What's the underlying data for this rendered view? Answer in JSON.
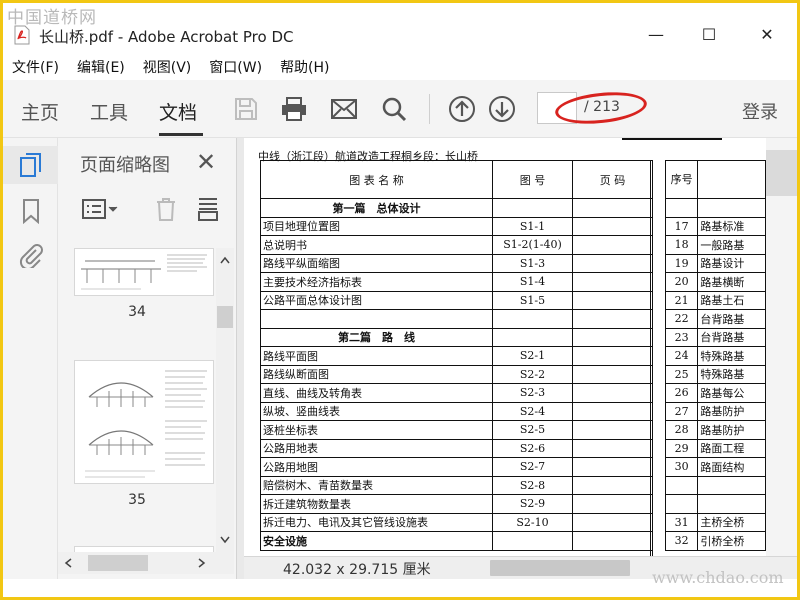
{
  "watermark": {
    "top": "中国道桥网",
    "bottom": "www.chdao.com"
  },
  "window": {
    "title": "长山桥.pdf - Adobe Acrobat Pro DC",
    "minimize": "—",
    "maximize": "☐",
    "close": "✕"
  },
  "menu": [
    "文件(F)",
    "编辑(E)",
    "视图(V)",
    "窗口(W)",
    "帮助(H)"
  ],
  "toolbar": {
    "tabs": [
      "主页",
      "工具",
      "文档"
    ],
    "active_tab": "文档",
    "page_current": "",
    "page_total": "/ 213",
    "login": "登录",
    "accent": "#d8231f"
  },
  "sidebar": {
    "icons": [
      "pages-icon",
      "bookmark-icon",
      "attachment-icon"
    ],
    "selected_color": "#2a7ad5"
  },
  "thumbnails": {
    "title": "页面缩略图",
    "close": "✕",
    "pages": [
      {
        "label": "34"
      },
      {
        "label": "35"
      }
    ]
  },
  "document": {
    "header": "中线（浙江段）航道改造工程桐乡段：长山桥",
    "columns": [
      "图 表 名 称",
      "图 号",
      "页 码"
    ],
    "rows": [
      {
        "name": "第一篇　总体设计",
        "code": "",
        "page": "",
        "section": true
      },
      {
        "name": "项目地理位置图",
        "code": "S1-1",
        "page": ""
      },
      {
        "name": "总说明书",
        "code": "S1-2(1-40)",
        "page": ""
      },
      {
        "name": "路线平纵面缩图",
        "code": "S1-3",
        "page": ""
      },
      {
        "name": "主要技术经济指标表",
        "code": "S1-4",
        "page": ""
      },
      {
        "name": "公路平面总体设计图",
        "code": "S1-5",
        "page": ""
      },
      {
        "name": "",
        "code": "",
        "page": ""
      },
      {
        "name": "第二篇　路　线",
        "code": "",
        "page": "",
        "section": true
      },
      {
        "name": "路线平面图",
        "code": "S2-1",
        "page": ""
      },
      {
        "name": "路线纵断面图",
        "code": "S2-2",
        "page": ""
      },
      {
        "name": "直线、曲线及转角表",
        "code": "S2-3",
        "page": ""
      },
      {
        "name": "纵坡、竖曲线表",
        "code": "S2-4",
        "page": ""
      },
      {
        "name": "逐桩坐标表",
        "code": "S2-5",
        "page": ""
      },
      {
        "name": "公路用地表",
        "code": "S2-6",
        "page": ""
      },
      {
        "name": "公路用地图",
        "code": "S2-7",
        "page": ""
      },
      {
        "name": "赔偿树木、青苗数量表",
        "code": "S2-8",
        "page": ""
      },
      {
        "name": "拆迁建筑物数量表",
        "code": "S2-9",
        "page": ""
      },
      {
        "name": "拆迁电力、电讯及其它管线设施表",
        "code": "S2-10",
        "page": ""
      },
      {
        "name": "安全设施",
        "code": "",
        "page": "",
        "section": true
      }
    ],
    "right_header": "序号",
    "right_rows": [
      {
        "no": "",
        "name": ""
      },
      {
        "no": "17",
        "name": "路基标准"
      },
      {
        "no": "18",
        "name": "一般路基"
      },
      {
        "no": "19",
        "name": "路基设计"
      },
      {
        "no": "20",
        "name": "路基横断"
      },
      {
        "no": "21",
        "name": "路基土石"
      },
      {
        "no": "22",
        "name": "台背路基"
      },
      {
        "no": "23",
        "name": "台背路基"
      },
      {
        "no": "24",
        "name": "特殊路基"
      },
      {
        "no": "25",
        "name": "特殊路基"
      },
      {
        "no": "26",
        "name": "路基每公"
      },
      {
        "no": "27",
        "name": "路基防护"
      },
      {
        "no": "28",
        "name": "路基防护"
      },
      {
        "no": "29",
        "name": "路面工程"
      },
      {
        "no": "30",
        "name": "路面结构"
      },
      {
        "no": "",
        "name": ""
      },
      {
        "no": "",
        "name": ""
      },
      {
        "no": "31",
        "name": "主桥全桥"
      },
      {
        "no": "32",
        "name": "引桥全桥"
      }
    ]
  },
  "status": {
    "dimensions": "42.032 x 29.715 厘米"
  }
}
